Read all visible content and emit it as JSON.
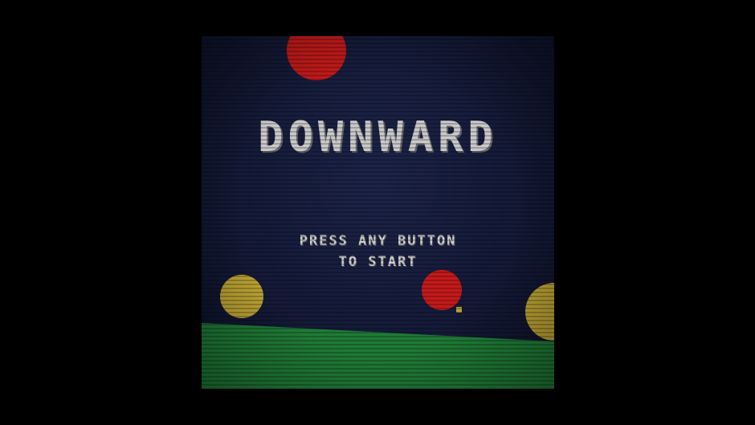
{
  "game": {
    "title": "DOWNWARD",
    "prompt_line_1": "PRESS ANY BUTTON",
    "prompt_line_2": "TO START"
  },
  "colors": {
    "letterbox": "#000000",
    "background": "#141a38",
    "red_ball": "#c41a1a",
    "yellow_ball": "#b8a032",
    "ground": "#1f7a36",
    "player": "#b8a032",
    "text": "#c9c9c9"
  }
}
